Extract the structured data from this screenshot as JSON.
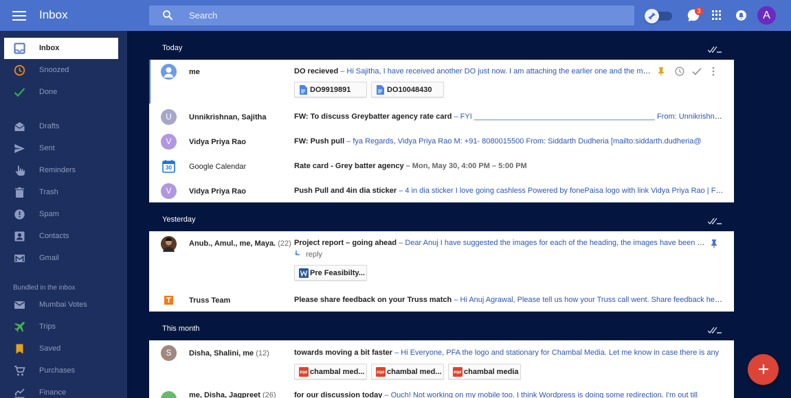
{
  "app": {
    "title": "Inbox"
  },
  "search": {
    "placeholder": "Search"
  },
  "topbar": {
    "reminder_badge": "3",
    "account_initial": "A"
  },
  "sidebar": {
    "items": [
      {
        "label": "Inbox",
        "icon": "inbox-icon"
      },
      {
        "label": "Snoozed",
        "icon": "clock-icon"
      },
      {
        "label": "Done",
        "icon": "check-icon"
      },
      {
        "label": "Drafts",
        "icon": "drafts-icon"
      },
      {
        "label": "Sent",
        "icon": "send-icon"
      },
      {
        "label": "Reminders",
        "icon": "reminder-hand-icon"
      },
      {
        "label": "Trash",
        "icon": "trash-icon"
      },
      {
        "label": "Spam",
        "icon": "spam-icon"
      },
      {
        "label": "Contacts",
        "icon": "contacts-icon"
      },
      {
        "label": "Gmail",
        "icon": "gmail-icon"
      }
    ],
    "bundled_heading": "Bundled in the inbox",
    "bundles": [
      {
        "label": "Mumbai Votes",
        "icon": "mail-icon"
      },
      {
        "label": "Trips",
        "icon": "plane-icon"
      },
      {
        "label": "Saved",
        "icon": "bookmark-icon"
      },
      {
        "label": "Purchases",
        "icon": "cart-icon"
      },
      {
        "label": "Finance",
        "icon": "finance-chart-icon"
      }
    ]
  },
  "sections": {
    "today": {
      "title": "Today",
      "rows": [
        {
          "sender": "me",
          "subject": "DO recieved",
          "snippet": " – Hi Sajitha, I have received another DO just now. I am attaching the earlier one and the most recent one for your reference.",
          "attachments": [
            "DO9919891",
            "DO10048430"
          ]
        },
        {
          "sender": "Unnikrishnan, Sajitha",
          "initial": "U",
          "subject": "FW: To discuss Greybatter agency rate card",
          "snippet": " – FYI ___________________________________________ From: Unnikrishnan, Sajitha..."
        },
        {
          "sender": "Vidya Priya Rao",
          "initial": "V",
          "subject": "FW: Push pull",
          "snippet": " – fya Regards, Vidya Priya Rao M: +91- 8080015500 From: Siddarth Dudheria [mailto:siddarth.dudheria@"
        },
        {
          "sender": "Google Calendar",
          "calendar_day": "30",
          "subject": "Rate card - Grey batter agency",
          "snippet": " – Mon, May 30, 4:00 PM – 5:00 PM"
        },
        {
          "sender": "Vidya Priya Rao",
          "initial": "V",
          "subject": "Push Pull and 4in dia sticker",
          "snippet": " – 4 in dia sticker I love going cashless Powered by fonePaisa logo with link Vidya Priya Rao | Founder"
        }
      ]
    },
    "yesterday": {
      "title": "Yesterday",
      "rows": [
        {
          "sender": "Anub., Amul., me, Maya.",
          "count": "(22)",
          "subject": "Project report – going ahead",
          "snippet": " – Dear Anuj I have suggested the images for each of the heading, the images have been picked from the web for now.",
          "reply": "reply",
          "attachments": [
            "Pre Feasibilty..."
          ]
        },
        {
          "sender": "Truss Team",
          "subject": "Please share feedback on your Truss match",
          "snippet": " – Hi Anuj Agrawal, Please tell us how your Truss call went. Share feedback here If you have a minute."
        }
      ]
    },
    "this_month": {
      "title": "This month",
      "rows": [
        {
          "sender": "Disha, Shalini, me",
          "count": "(12)",
          "initial": "S",
          "subject": "towards moving a bit faster",
          "snippet": " – Hi Everyone, PFA the logo and stationary for Chambal Media. Let me know in case there is any",
          "attachments": [
            "chambal med...",
            "chambal med...",
            "chambal media"
          ]
        },
        {
          "sender": "me, Disha, Jagpreet",
          "count": "(26)",
          "subject": "for our discussion today",
          "snippet": " – Ouch! Not working on my mobile too. I think Wordpress is doing some redirection. I'm out till"
        }
      ]
    }
  },
  "colors": {
    "accent": "#4a72cc",
    "background": "#04163f",
    "sidebar": "#1c2f5e",
    "fab": "#db4437",
    "pin": "#e5a11b",
    "done": "#2fa84f",
    "snoozed": "#ef8b12"
  }
}
